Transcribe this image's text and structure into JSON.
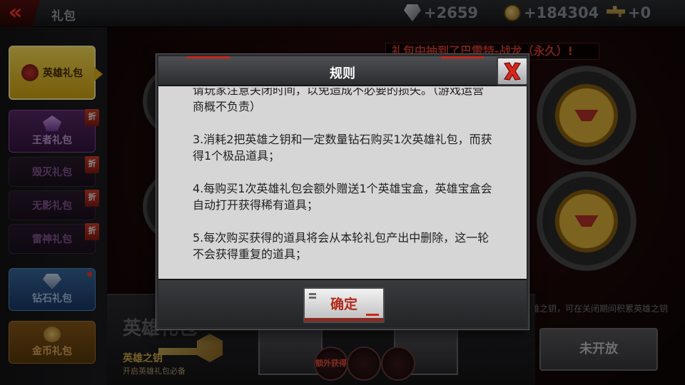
{
  "header": {
    "back_icon": "double-chevron-left-icon",
    "title": "礼包",
    "currencies": [
      {
        "icon": "diamond-icon",
        "value": "+2659"
      },
      {
        "icon": "coin-icon",
        "value": "+184304"
      },
      {
        "icon": "key-icon",
        "value": "+0"
      }
    ]
  },
  "sidebar": {
    "items": [
      {
        "label": "英雄礼包",
        "selected": true
      },
      {
        "label": "王者礼包",
        "badge": "折"
      },
      {
        "label": "毁灭礼包",
        "badge": "折"
      },
      {
        "label": "无影礼包",
        "badge": "折"
      },
      {
        "label": "雷神礼包",
        "badge": "折"
      },
      {
        "label": "钻石礼包"
      },
      {
        "label": "金币礼包"
      }
    ]
  },
  "main": {
    "marquee": "礼包中抽到了巴雷特-战龙（永久）!",
    "hint": "英雄礼包购买需英雄之钥，可在关闭期间积累英雄之钥",
    "bottom_title": "英雄礼包",
    "key_name": "英雄之钥",
    "key_desc": "开启英雄礼包必备",
    "gift_badge_label": "额外获得",
    "closed_button": "未开放"
  },
  "dialog": {
    "title": "规则",
    "close_icon": "close-x-icon",
    "paragraphs": [
      "请玩家注意关闭时间，以免造成不必要的损失。（游戏运营商概不负责）",
      "3.消耗2把英雄之钥和一定数量钻石购买1次英雄礼包，而获得1个极品道具；",
      "4.每购买1次英雄礼包会额外赠送1个英雄宝盒，英雄宝盒会自动打开获得稀有道具；",
      "5.每次购买获得的道具将会从本轮礼包产出中删除，这一轮不会获得重复的道具；"
    ],
    "confirm_label": "确定"
  },
  "colors": {
    "accent_red": "#c8281c",
    "hero_gold": "#e6b81c",
    "dialog_bg": "#d6d6d6"
  }
}
